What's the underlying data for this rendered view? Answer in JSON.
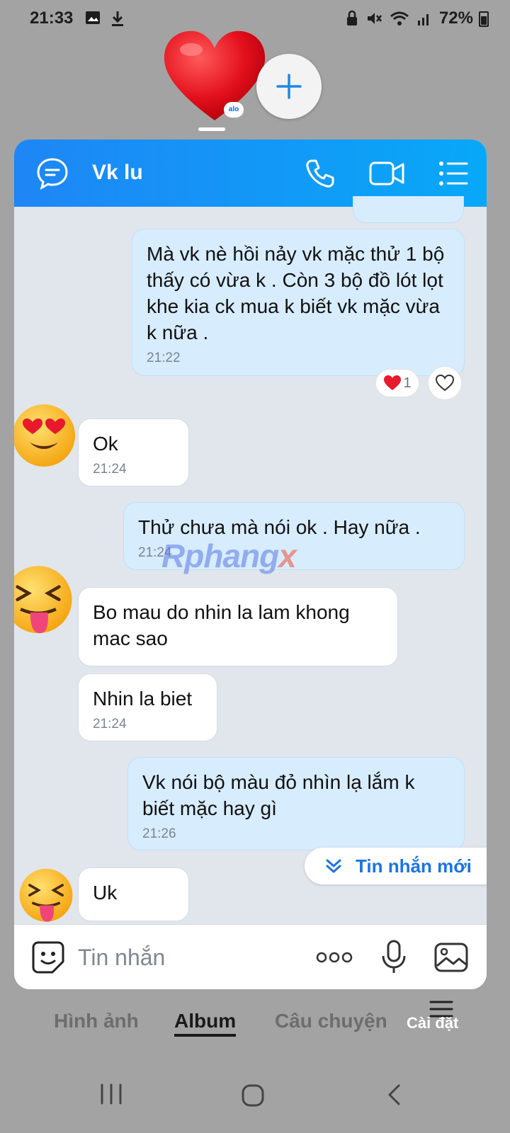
{
  "status_bar": {
    "time": "21:33",
    "battery": "72%"
  },
  "bubbles": {
    "mini_badge": "alo"
  },
  "chat": {
    "contact_name": "Vk lu",
    "messages": [
      {
        "dir": "out",
        "text": "Mà vk nè hồi nảy vk mặc thử 1 bộ thấy có vừa k . Còn 3 bộ đồ lót lọt khe kia ck mua k biết vk mặc vừa k nữa .",
        "time": "21:22"
      },
      {
        "dir": "in",
        "text": "Ok",
        "time": "21:24"
      },
      {
        "dir": "out",
        "text": "Thử chưa mà nói ok . Hay nữa .",
        "time": "21:24"
      },
      {
        "dir": "in",
        "text": "Bo mau do nhin la lam khong mac sao",
        "time": ""
      },
      {
        "dir": "in",
        "text": "Nhin la biet",
        "time": "21:24"
      },
      {
        "dir": "out",
        "text": "Vk nói bộ màu đỏ nhìn lạ lắm k biết mặc hay gì",
        "time": "21:26"
      },
      {
        "dir": "in",
        "text": "Uk",
        "time": ""
      }
    ],
    "reaction_count": "1",
    "new_messages_label": "Tin nhắn mới",
    "input_placeholder": "Tin nhắn"
  },
  "watermark": {
    "main": "Rphang",
    "tail": "x"
  },
  "background_tabs": {
    "tabs": [
      "Hình ảnh",
      "Album",
      "Câu chuyện"
    ],
    "active": "Album",
    "settings_label": "Cài đặt"
  },
  "colors": {
    "header_start": "#1e86f5",
    "header_end": "#08a8f8",
    "outgoing_bubble": "#d7ecfd",
    "incoming_bubble": "#ffffff",
    "accent": "#1a73e8"
  },
  "icons": {
    "status_left": [
      "image-icon",
      "download-icon"
    ],
    "status_right": [
      "lock-icon",
      "mute-icon",
      "wifi-icon",
      "signal-icon",
      "battery-icon"
    ],
    "header": [
      "chat-icon",
      "phone-icon",
      "video-icon",
      "list-icon"
    ],
    "input": [
      "sticker-icon",
      "more-icon",
      "mic-icon",
      "image-icon"
    ],
    "nav": [
      "recent-apps-icon",
      "home-icon",
      "back-icon"
    ]
  }
}
